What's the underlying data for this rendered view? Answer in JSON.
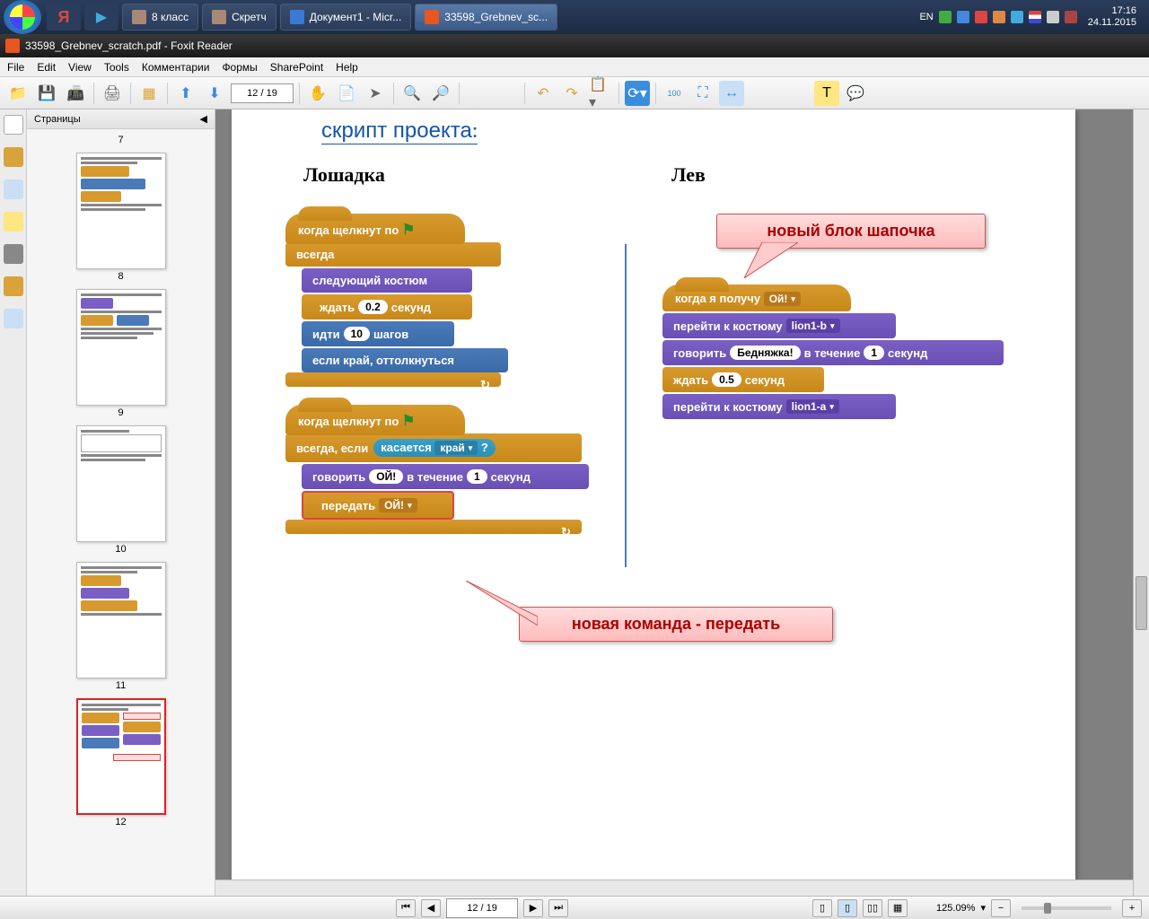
{
  "taskbar": {
    "tasks": [
      {
        "label": "8 класс"
      },
      {
        "label": "Скретч"
      },
      {
        "label": "Документ1 - Micr..."
      },
      {
        "label": "33598_Grebnev_sc..."
      }
    ],
    "lang": "EN",
    "time": "17:16",
    "date": "24.11.2015"
  },
  "titlebar": "33598_Grebnev_scratch.pdf - Foxit Reader",
  "menu": [
    "File",
    "Edit",
    "View",
    "Tools",
    "Комментарии",
    "Формы",
    "SharePoint",
    "Help"
  ],
  "toolbar": {
    "page": "12 / 19"
  },
  "sidebar": {
    "header": "Страницы",
    "thumbs": [
      "7",
      "8",
      "9",
      "10",
      "11",
      "12"
    ],
    "selected": "12"
  },
  "doc": {
    "heading": "скрипт проекта",
    "col1_title": "Лошадка",
    "col2_title": "Лев",
    "callout1": "новый блок шапочка",
    "callout2": "новая команда - передать",
    "script1": {
      "hat": "когда щелкнут по",
      "forever": "всегда",
      "b1": "следующий костюм",
      "b2a": "ждать",
      "b2v": "0.2",
      "b2b": "секунд",
      "b3a": "идти",
      "b3v": "10",
      "b3b": "шагов",
      "b4": "если край, оттолкнуться"
    },
    "script2": {
      "hat": "когда щелкнут по",
      "c1a": "всегда, если",
      "c1b": "касается",
      "c1v": "край",
      "c1q": "?",
      "b1a": "говорить",
      "b1v": "ОЙ!",
      "b1b": "в течение",
      "b1n": "1",
      "b1c": "секунд",
      "b2a": "передать",
      "b2v": "ОЙ!"
    },
    "script3": {
      "hat": "когда я получу",
      "hatv": "Ой!",
      "b1a": "перейти к костюму",
      "b1v": "lion1-b",
      "b2a": "говорить",
      "b2v": "Бедняжка!",
      "b2b": "в течение",
      "b2n": "1",
      "b2c": "секунд",
      "b3a": "ждать",
      "b3v": "0.5",
      "b3b": "секунд",
      "b4a": "перейти к костюму",
      "b4v": "lion1-a"
    }
  },
  "statusbar": {
    "page": "12 / 19",
    "zoom": "125.09%"
  }
}
